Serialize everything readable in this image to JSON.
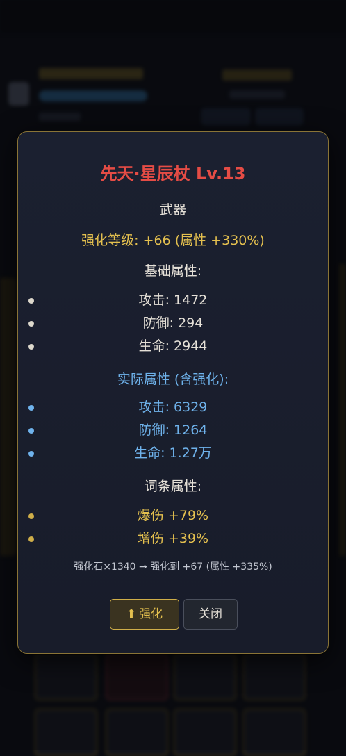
{
  "item": {
    "title": "先天·星辰杖 Lv.13",
    "category": "武器",
    "enhance_level": "强化等级: +66 (属性 +330%)"
  },
  "base_stats": {
    "heading": "基础属性:",
    "items": [
      "攻击: 1472",
      "防御: 294",
      "生命: 2944"
    ]
  },
  "actual_stats": {
    "heading": "实际属性 (含强化):",
    "items": [
      "攻击: 6329",
      "防御: 1264",
      "生命: 1.27万"
    ]
  },
  "affix_stats": {
    "heading": "词条属性:",
    "items": [
      "爆伤 +79%",
      "增伤 +39%"
    ]
  },
  "cost_text": "强化石×1340 → 强化到 +67 (属性 +335%)",
  "buttons": {
    "enhance_icon": "⬆",
    "enhance_label": "强化",
    "close_label": "关闭"
  },
  "colors": {
    "title": "#e54c45",
    "gold": "#e4c04f",
    "blue": "#6fb3ec",
    "border": "#8a7436"
  }
}
